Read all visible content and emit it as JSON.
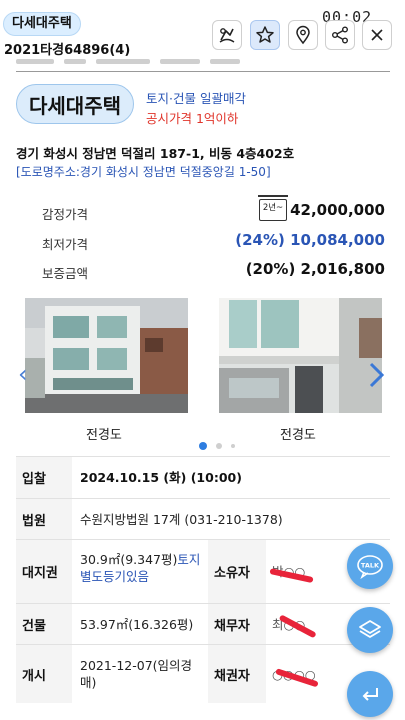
{
  "header": {
    "type_chip": "다세대주택",
    "case_no": "2021타경64896(4)",
    "clock": "00:02",
    "icons": [
      "share-alt-icon",
      "star-icon",
      "map-pin-icon",
      "share-icon",
      "close-icon"
    ]
  },
  "summary": {
    "type_label": "다세대주택",
    "tag_primary": "토지·건물 일괄매각",
    "tag_secondary": "공시가격 1억이하",
    "address": "경기 화성시 정남면 덕절리 187-1, 비동 4층402호",
    "road_address": "[도로명주소:경기 화성시 정남면 덕절중앙길 1-50]"
  },
  "prices": {
    "appraisal_label": "감정가격",
    "appraisal_badge": "2년~",
    "appraisal_value": "42,000,000",
    "minimum_label": "최저가격",
    "minimum_value": "(24%) 10,084,000",
    "deposit_label": "보증금액",
    "deposit_value": "(20%) 2,016,800"
  },
  "photos": {
    "captions": [
      "전경도",
      "전경도"
    ],
    "pager": {
      "count": 3,
      "active": 0
    }
  },
  "details": {
    "bid_label": "입찰",
    "bid_value": "2024.10.15 (화) (10:00)",
    "court_label": "법원",
    "court_value": "수원지방법원 17계 (031-210-1378)",
    "land_label": "대지권",
    "land_value_plain": "30.9㎡(9.347평)",
    "land_value_link": "토지별도등기있음",
    "owner_label": "소유자",
    "owner_value": "박○○",
    "building_label": "건물",
    "building_value": "53.97㎡(16.326평)",
    "debtor_label": "채무자",
    "debtor_value": "최○○",
    "start_label": "개시",
    "start_value": "2021-12-07(임의경매)",
    "creditor_label": "채권자",
    "creditor_value": "○○○○"
  },
  "fabs": {
    "talk_label": "TALK"
  },
  "colors": {
    "accent_blue": "#2a55b5",
    "warning_red": "#e0352b",
    "fab_blue": "#5aa7ea",
    "redaction": "#e8243a"
  }
}
